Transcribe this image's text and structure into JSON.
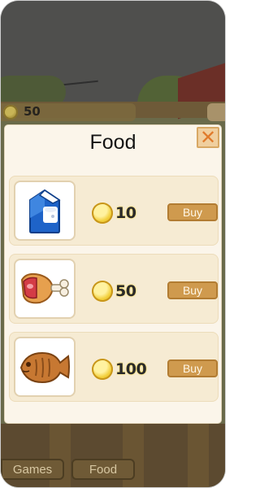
{
  "hud": {
    "coins": "50"
  },
  "modal": {
    "title": "Food",
    "close_label": "✕",
    "items": [
      {
        "icon": "milk-carton-icon",
        "price": "10",
        "buy_label": "Buy"
      },
      {
        "icon": "ham-leg-icon",
        "price": "50",
        "buy_label": "Buy"
      },
      {
        "icon": "fish-taiyaki-icon",
        "price": "100",
        "buy_label": "Buy"
      }
    ]
  },
  "nav": {
    "games_label": "Games",
    "food_label": "Food"
  },
  "colors": {
    "modal_bg": "#fbf5ea",
    "buy_button": "#cf9a4e",
    "coin": "#f2cf3a",
    "close_icon": "#e07a2b"
  }
}
